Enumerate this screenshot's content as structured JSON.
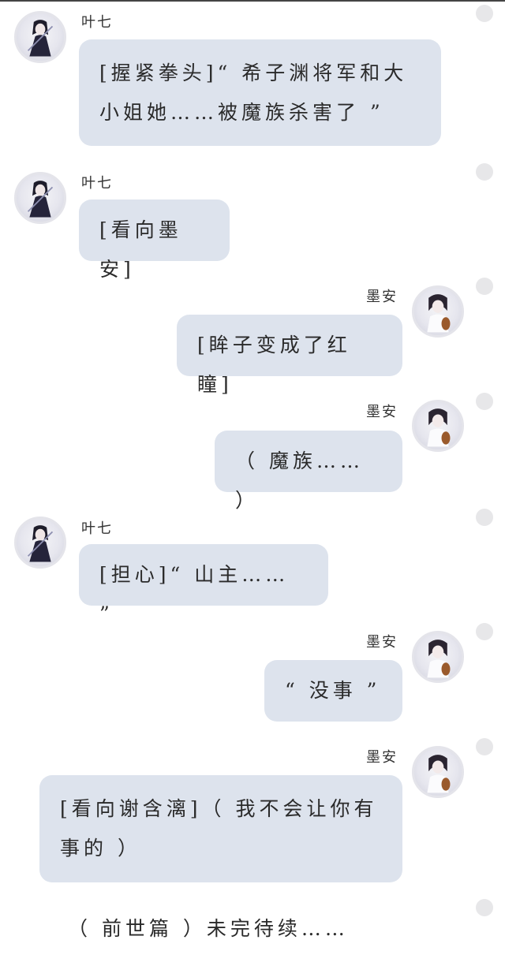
{
  "messages": [
    {
      "side": "left",
      "name": "叶七",
      "text": "[握紧拳头]“ 希子渊将军和大小姐她……被魔族杀害了 ”"
    },
    {
      "side": "left",
      "name": "叶七",
      "text": "[看向墨安]"
    },
    {
      "side": "right",
      "name": "墨安",
      "text": "[眸子变成了红瞳]"
    },
    {
      "side": "right",
      "name": "墨安",
      "text": "（ 魔族…… ）"
    },
    {
      "side": "left",
      "name": "叶七",
      "text": "[担心]“ 山主…… ”"
    },
    {
      "side": "right",
      "name": "墨安",
      "text": "“ 没事 ”"
    },
    {
      "side": "right",
      "name": "墨安",
      "text": "[看向谢含漓]（ 我不会让你有事的 ）"
    }
  ],
  "footer": "（ 前世篇 ）未完待续……",
  "colors": {
    "bubble": "#dde3ed",
    "background": "#ffffff",
    "dot": "#e7e7e9"
  },
  "icons": {
    "left_avatar": "dark-haired-character-avatar",
    "right_avatar": "character-with-violin-avatar",
    "status": "grey-dot-icon"
  }
}
